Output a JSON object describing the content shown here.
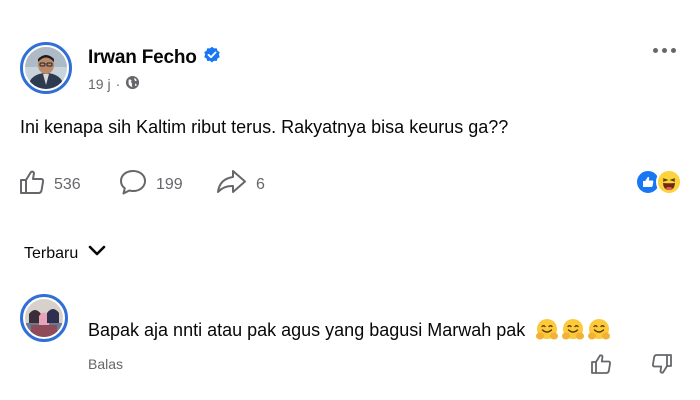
{
  "post": {
    "author": "Irwan Fecho",
    "time": "19 j",
    "separator": "·",
    "text": "Ini kenapa sih Kaltim ribut terus. Rakyatnya bisa keurus ga??",
    "likes": "536",
    "comments": "199",
    "shares": "6",
    "reaction_icons": [
      "like-reaction",
      "haha-reaction"
    ]
  },
  "sort": {
    "label": "Terbaru"
  },
  "comments": [
    {
      "text": "Bapak aja nnti atau pak agus yang bagusi Marwah pak",
      "emojis": [
        "hugging-face-emoji",
        "hugging-face-emoji",
        "hugging-face-emoji"
      ],
      "reply_label": "Balas"
    }
  ],
  "colors": {
    "accent": "#1877f2",
    "verified": "#1877f2",
    "muted": "#65676b",
    "ring": "#2f6fd6"
  }
}
